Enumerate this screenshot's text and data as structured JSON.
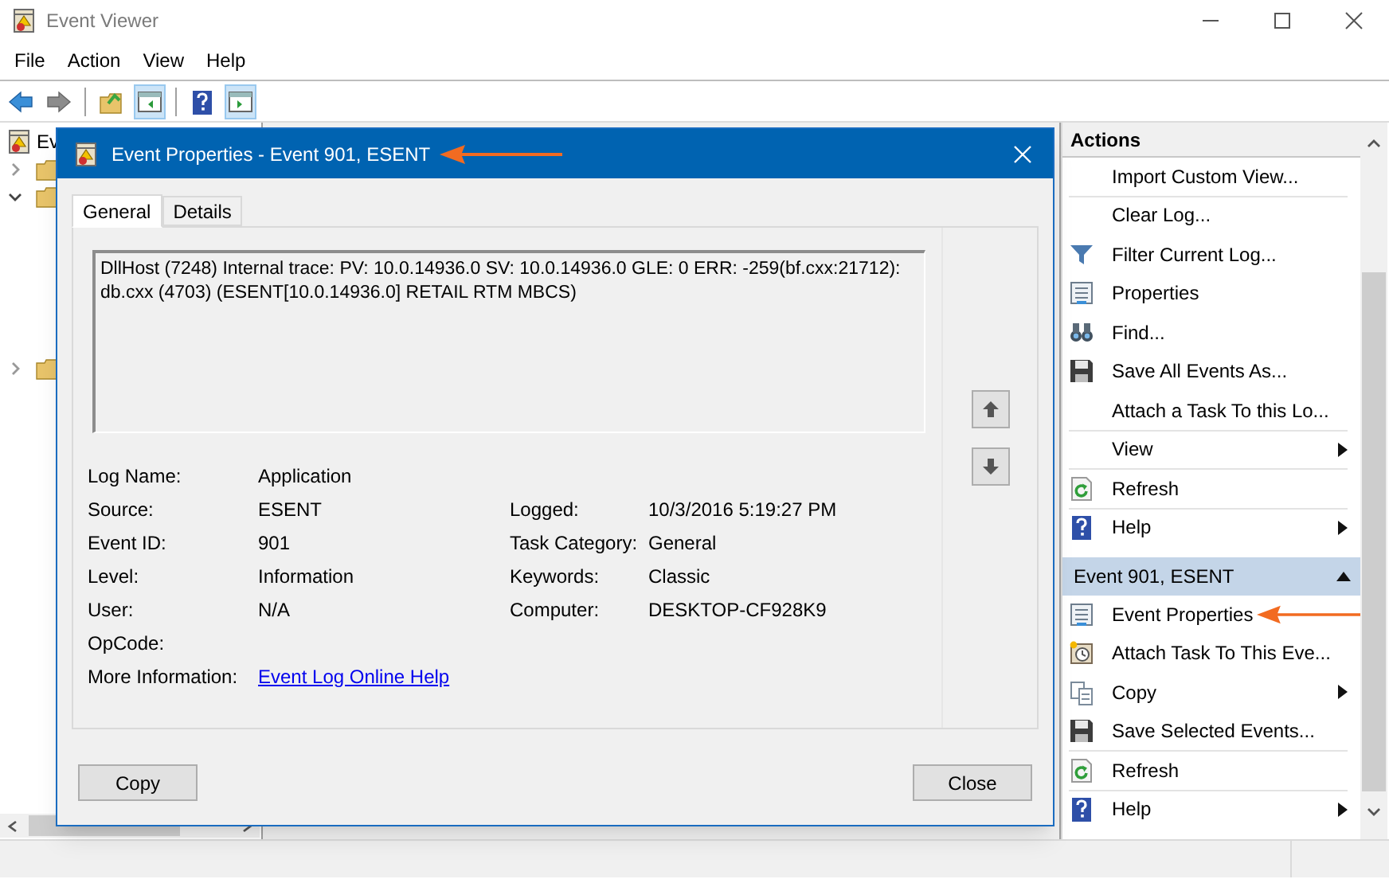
{
  "window": {
    "title": "Event Viewer"
  },
  "menu": [
    "File",
    "Action",
    "View",
    "Help"
  ],
  "toolbar": [
    {
      "kind": "back",
      "pressed": false
    },
    {
      "kind": "forward",
      "pressed": false
    },
    {
      "kind": "separator"
    },
    {
      "kind": "folder",
      "pressed": false
    },
    {
      "kind": "console-tree",
      "pressed": true
    },
    {
      "kind": "separator"
    },
    {
      "kind": "help",
      "pressed": false
    },
    {
      "kind": "action-pane",
      "pressed": true
    }
  ],
  "tree": {
    "label": "Ev",
    "items": [
      {
        "expanded": false
      },
      {
        "expanded": true
      },
      {
        "expanded": false
      }
    ]
  },
  "dialog": {
    "title": "Event Properties - Event 901, ESENT",
    "tabs": [
      {
        "label": "General",
        "selected": true
      },
      {
        "label": "Details",
        "selected": false
      }
    ],
    "description": "DllHost (7248) Internal trace: PV: 10.0.14936.0 SV: 10.0.14936.0 GLE: 0 ERR: -259(bf.cxx:21712): db.cxx (4703) (ESENT[10.0.14936.0] RETAIL RTM MBCS)",
    "rows": [
      {
        "label": "Log Name:",
        "value": "Application"
      },
      {
        "label": "Source:",
        "value": "ESENT",
        "label_2": "Logged:",
        "value_2": "10/3/2016 5:19:27 PM"
      },
      {
        "label": "Event ID:",
        "value": "901",
        "label_2": "Task Category:",
        "value_2": "General"
      },
      {
        "label": "Level:",
        "value": "Information",
        "label_2": "Keywords:",
        "value_2": "Classic"
      },
      {
        "label": "User:",
        "value": "N/A",
        "label_2": "Computer:",
        "value_2": "DESKTOP-CF928K9"
      },
      {
        "label": "OpCode:"
      },
      {
        "label": "More Information:",
        "value": "Event Log Online Help",
        "kind": "link"
      }
    ],
    "buttons": [
      "Copy",
      "Close"
    ]
  },
  "actions": {
    "title": "Actions",
    "items": [
      {
        "kind": "plain",
        "label": "Import Custom View...",
        "submenu": false,
        "divider_after": true
      },
      {
        "kind": "plain",
        "label": "Clear Log...",
        "submenu": false,
        "divider_after": false
      },
      {
        "kind": "filter",
        "label": "Filter Current Log...",
        "submenu": false,
        "divider_after": false
      },
      {
        "kind": "properties",
        "label": "Properties",
        "submenu": false,
        "divider_after": false
      },
      {
        "kind": "find",
        "label": "Find...",
        "submenu": false,
        "divider_after": false
      },
      {
        "kind": "save",
        "label": "Save All Events As...",
        "submenu": false,
        "divider_after": false
      },
      {
        "kind": "plain",
        "label": "Attach a Task To this Lo...",
        "submenu": false,
        "divider_after": true
      },
      {
        "kind": "plain",
        "label": "View",
        "submenu": true,
        "divider_after": true
      },
      {
        "kind": "refresh",
        "label": "Refresh",
        "submenu": false,
        "divider_after": true
      },
      {
        "kind": "help",
        "label": "Help",
        "submenu": true,
        "divider_after": false
      }
    ],
    "section": {
      "title": "Event 901, ESENT",
      "expanded": true,
      "items": [
        {
          "kind": "properties",
          "label": "Event Properties",
          "submenu": false,
          "divider_after": false
        },
        {
          "kind": "task",
          "label": "Attach Task To This Eve...",
          "submenu": false,
          "divider_after": false
        },
        {
          "kind": "copy",
          "label": "Copy",
          "submenu": true,
          "divider_after": false
        },
        {
          "kind": "save",
          "label": "Save Selected Events...",
          "submenu": false,
          "divider_after": true
        },
        {
          "kind": "refresh",
          "label": "Refresh",
          "submenu": false,
          "divider_after": true
        },
        {
          "kind": "help",
          "label": "Help",
          "submenu": true,
          "divider_after": false
        }
      ]
    }
  }
}
